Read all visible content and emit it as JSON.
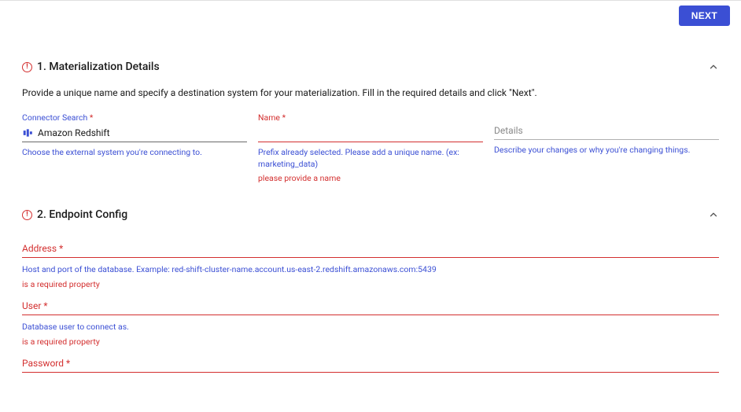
{
  "topbar": {
    "next_label": "NEXT"
  },
  "section1": {
    "title": "1. Materialization Details",
    "description": "Provide a unique name and specify a destination system for your materialization. Fill in the required details and click \"Next\".",
    "connector": {
      "label": "Connector Search",
      "value": "Amazon Redshift",
      "icon": "amazon-redshift",
      "helper": "Choose the external system you're connecting to."
    },
    "name": {
      "label": "Name",
      "value": "",
      "helper": "Prefix already selected. Please add a unique name. (ex: marketing_data)",
      "error": "please provide a name"
    },
    "details": {
      "label": "Details",
      "value": "",
      "helper": "Describe your changes or why you're changing things."
    }
  },
  "section2": {
    "title": "2. Endpoint Config",
    "fields": {
      "address": {
        "label": "Address",
        "helper": "Host and port of the database. Example: red-shift-cluster-name.account.us-east-2.redshift.amazonaws.com:5439",
        "error": "is a required property"
      },
      "user": {
        "label": "User",
        "helper": "Database user to connect as.",
        "error": "is a required property"
      },
      "password": {
        "label": "Password"
      }
    }
  }
}
